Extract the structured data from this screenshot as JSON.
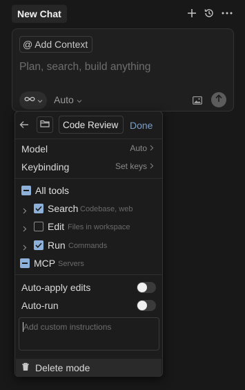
{
  "header": {
    "tab_title": "New Chat",
    "icons": [
      "plus-icon",
      "history-icon",
      "more-icon"
    ]
  },
  "composer": {
    "add_context_label": "Add Context",
    "at_symbol": "@",
    "placeholder": "Plan, search, build anything",
    "model_selector": "Auto"
  },
  "panel": {
    "mode_name": "Code Review",
    "done_label": "Done",
    "settings": [
      {
        "label": "Model",
        "value": "Auto"
      },
      {
        "label": "Keybinding",
        "value": "Set keys"
      }
    ],
    "all_tools_label": "All tools",
    "tools": [
      {
        "name": "Search",
        "desc": "Codebase, web",
        "checked": true
      },
      {
        "name": "Edit",
        "desc": "Files in workspace",
        "checked": false
      },
      {
        "name": "Run",
        "desc": "Commands",
        "checked": true
      }
    ],
    "mcp_label": "MCP",
    "mcp_desc": "Servers",
    "toggles": [
      {
        "label": "Auto-apply edits",
        "on": false
      },
      {
        "label": "Auto-run",
        "on": false
      }
    ],
    "instructions_placeholder": "Add custom instructions",
    "delete_label": "Delete mode"
  },
  "colors": {
    "background": "#181818",
    "checkbox_accent": "#8eb1d9",
    "done_link": "#7b9fcc"
  }
}
